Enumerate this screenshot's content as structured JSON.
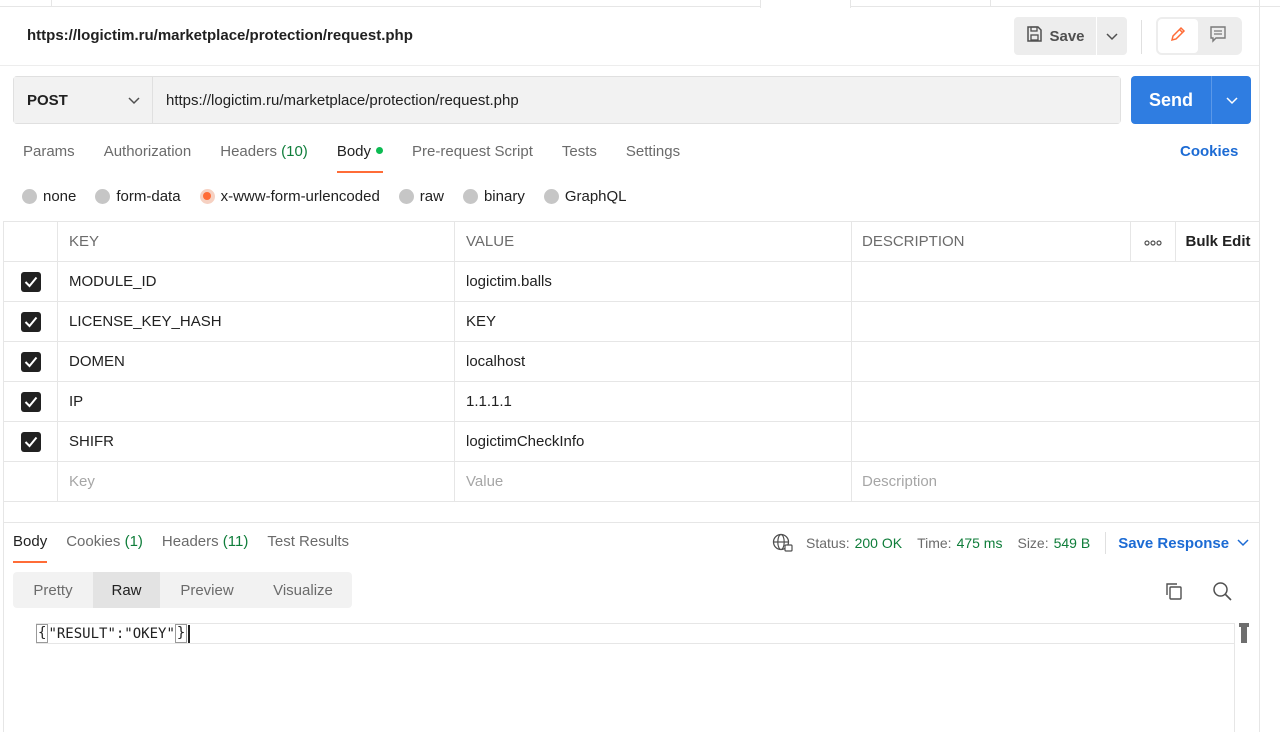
{
  "request": {
    "title": "https://logictim.ru/marketplace/protection/request.php",
    "save_label": "Save",
    "method": "POST",
    "url": "https://logictim.ru/marketplace/protection/request.php",
    "send_label": "Send"
  },
  "request_tabs": [
    {
      "label": "Params",
      "count": ""
    },
    {
      "label": "Authorization",
      "count": ""
    },
    {
      "label": "Headers",
      "count": "(10)"
    },
    {
      "label": "Body",
      "count": ""
    },
    {
      "label": "Pre-request Script",
      "count": ""
    },
    {
      "label": "Tests",
      "count": ""
    },
    {
      "label": "Settings",
      "count": ""
    }
  ],
  "cookies_link": "Cookies",
  "body_types": [
    "none",
    "form-data",
    "x-www-form-urlencoded",
    "raw",
    "binary",
    "GraphQL"
  ],
  "body_type_selected": "x-www-form-urlencoded",
  "table": {
    "headers": {
      "key": "KEY",
      "value": "VALUE",
      "description": "DESCRIPTION",
      "bulk_edit": "Bulk Edit"
    },
    "rows": [
      {
        "checked": true,
        "key": "MODULE_ID",
        "value": "logictim.balls",
        "description": ""
      },
      {
        "checked": true,
        "key": "LICENSE_KEY_HASH",
        "value": "KEY",
        "description": ""
      },
      {
        "checked": true,
        "key": "DOMEN",
        "value": "localhost",
        "description": ""
      },
      {
        "checked": true,
        "key": "IP",
        "value": "1.1.1.1",
        "description": ""
      },
      {
        "checked": true,
        "key": "SHIFR",
        "value": "logictimCheckInfo",
        "description": ""
      }
    ],
    "placeholders": {
      "key": "Key",
      "value": "Value",
      "description": "Description"
    }
  },
  "response_tabs": [
    {
      "label": "Body",
      "count": ""
    },
    {
      "label": "Cookies",
      "count": "(1)"
    },
    {
      "label": "Headers",
      "count": "(11)"
    },
    {
      "label": "Test Results",
      "count": ""
    }
  ],
  "response_status": {
    "status_label": "Status:",
    "status_value": "200 OK",
    "time_label": "Time:",
    "time_value": "475 ms",
    "size_label": "Size:",
    "size_value": "549 B",
    "save_response": "Save Response"
  },
  "format_tabs": [
    "Pretty",
    "Raw",
    "Preview",
    "Visualize"
  ],
  "format_selected": "Raw",
  "response_body": {
    "open": "{",
    "content": "\"RESULT\":\"OKEY\"",
    "close": "}"
  },
  "colors": {
    "accent": "#ff6c37",
    "send": "#2f7de1",
    "link": "#1c6bd4",
    "success": "#0f7d3a"
  },
  "icons": [
    "save-icon",
    "chevron-down-icon",
    "pencil-icon",
    "comment-icon",
    "globe-icon",
    "copy-icon",
    "search-icon",
    "more-icon"
  ]
}
